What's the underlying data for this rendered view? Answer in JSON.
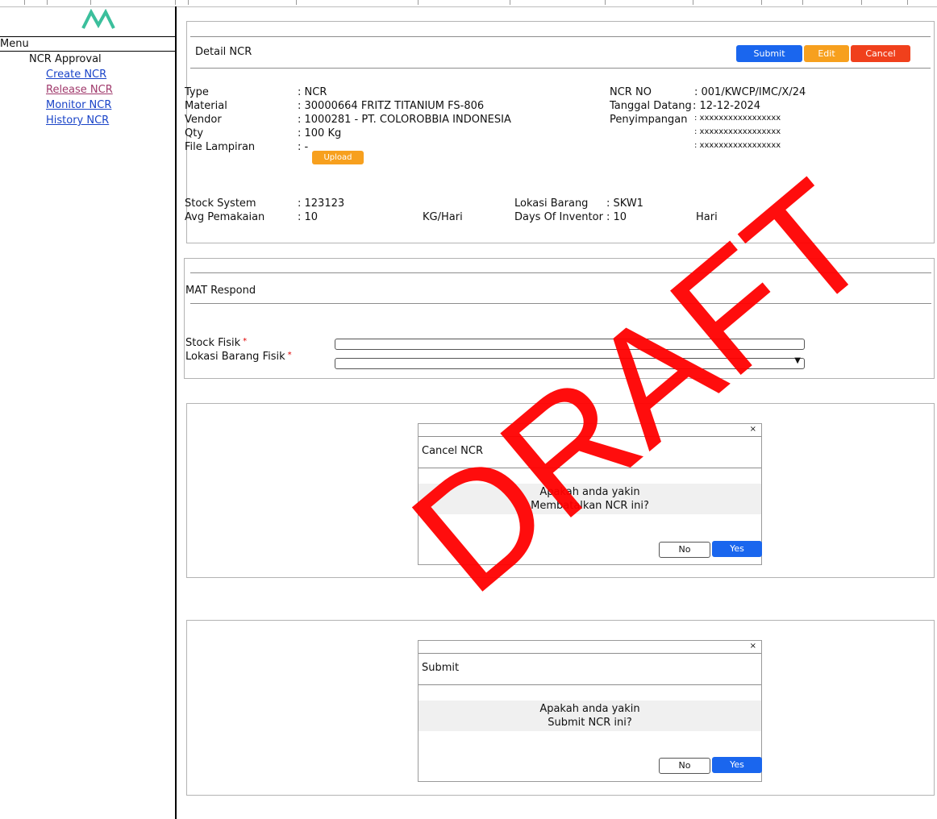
{
  "sidebar": {
    "menu_title": "Menu",
    "group_label": "NCR Approval",
    "links": [
      {
        "label": "Create NCR",
        "active": false
      },
      {
        "label": "Release NCR",
        "active": true
      },
      {
        "label": "Monitor NCR",
        "active": false
      },
      {
        "label": "History NCR",
        "active": false
      }
    ],
    "logo_icon": "logo-mountain-icon",
    "logo_color": "#3bbf9c"
  },
  "detail": {
    "title": "Detail NCR",
    "buttons": {
      "submit": "Submit",
      "edit": "Edit",
      "cancel": "Cancel"
    },
    "colors": {
      "submit": "#1a66ee",
      "edit": "#f7a01e",
      "cancel": "#f0401c"
    },
    "left_fields": [
      {
        "label": "Type",
        "value": ": NCR"
      },
      {
        "label": "Material",
        "value": ": 30000664 FRITZ TITANIUM FS-806"
      },
      {
        "label": "Vendor",
        "value": ": 1000281 - PT. COLOROBBIA INDONESIA"
      },
      {
        "label": "Qty",
        "value": ": 100 Kg"
      },
      {
        "label": "File Lampiran",
        "value": ": -"
      }
    ],
    "upload_label": "Upload",
    "right_fields": [
      {
        "label": "NCR NO",
        "value": ": 001/KWCP/IMC/X/24"
      },
      {
        "label": "Tanggal Datang",
        "value": ": 12-12-2024"
      },
      {
        "label": "Penyimpangan",
        "value": ": xxxxxxxxxxxxxxxxx"
      },
      {
        "label": "",
        "value": ": xxxxxxxxxxxxxxxxx"
      },
      {
        "label": "",
        "value": ": xxxxxxxxxxxxxxxxx"
      }
    ],
    "stock_system_label": "Stock System",
    "stock_system_value": ": 123123",
    "avg_label": "Avg Pemakaian",
    "avg_value": ": 10",
    "avg_unit": "KG/Hari",
    "lokasi_label": "Lokasi Barang",
    "lokasi_value": ": SKW1",
    "days_label": "Days Of Inventor",
    "days_value": ": 10",
    "days_unit": "Hari"
  },
  "mat": {
    "title": "MAT Respond",
    "stock_fisik_label": "Stock Fisik",
    "lokasi_fisik_label": "Lokasi Barang Fisik",
    "required_mark": "*",
    "dropdown_arrow": "▼"
  },
  "cancel_dialog": {
    "close": "×",
    "title": "Cancel NCR",
    "line1": "Apakah anda yakin",
    "line2": "Membatalkan NCR ini?",
    "no": "No",
    "yes": "Yes"
  },
  "submit_dialog": {
    "close": "×",
    "title": "Submit",
    "line1": "Apakah anda yakin",
    "line2": "Submit NCR ini?",
    "no": "No",
    "yes": "Yes"
  },
  "watermark": "DRAFT"
}
